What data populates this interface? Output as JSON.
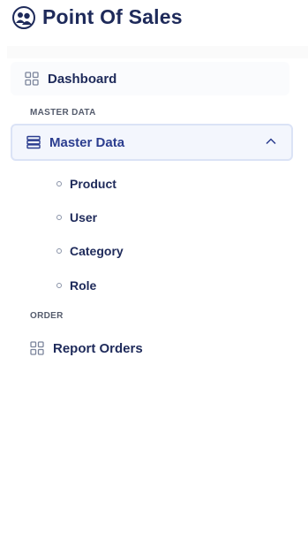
{
  "brand": {
    "title": "Point Of Sales",
    "logo_icon": "users-icon"
  },
  "nav": {
    "dashboard": {
      "label": "Dashboard",
      "icon": "grid-icon"
    },
    "section_master": "MASTER DATA",
    "master": {
      "label": "Master Data",
      "icon": "list-icon",
      "expanded": true
    },
    "master_items": [
      {
        "label": "Product"
      },
      {
        "label": "User"
      },
      {
        "label": "Category"
      },
      {
        "label": "Role"
      }
    ],
    "section_order": "ORDER",
    "report": {
      "label": "Report Orders",
      "icon": "grid-icon"
    }
  },
  "colors": {
    "text": "#1e2a5a",
    "active_bg": "#f3f6fd",
    "active_border": "#dbe3f6"
  }
}
